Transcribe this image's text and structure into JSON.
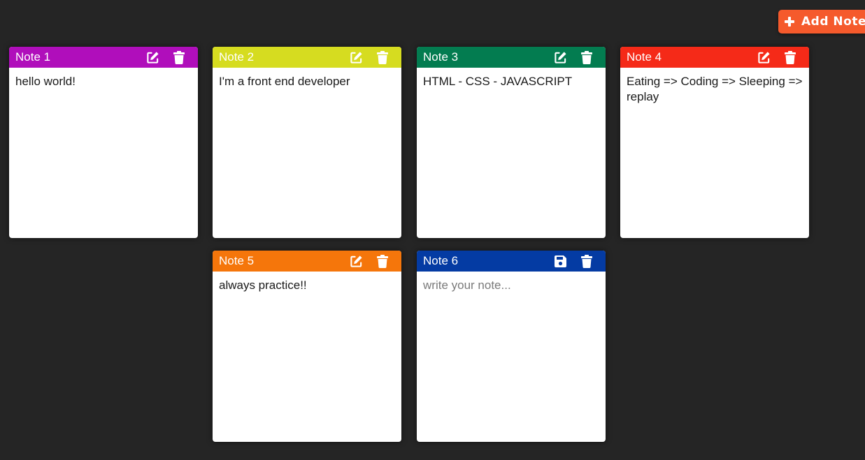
{
  "toolbar": {
    "add_label": "Add Note",
    "add_color": "#f55a2c"
  },
  "notes": [
    {
      "title": "Note 1",
      "content": "hello world!",
      "color": "#b00ebb",
      "mode": "view"
    },
    {
      "title": "Note 2",
      "content": "I'm a front end developer",
      "color": "#d6dc20",
      "mode": "view"
    },
    {
      "title": "Note 3",
      "content": "HTML - CSS - JAVASCRIPT",
      "color": "#037c50",
      "mode": "view"
    },
    {
      "title": "Note 4",
      "content": "Eating => Coding => Sleeping => replay",
      "color": "#f52a18",
      "mode": "view"
    },
    {
      "title": "Note 5",
      "content": "always practice!!",
      "color": "#f5760b",
      "mode": "view"
    },
    {
      "title": "Note 6",
      "content": "",
      "placeholder": "write your note...",
      "color": "#043ba3",
      "mode": "edit"
    }
  ],
  "icons": {
    "edit": "edit-icon",
    "delete": "trash-icon",
    "save": "save-icon"
  }
}
